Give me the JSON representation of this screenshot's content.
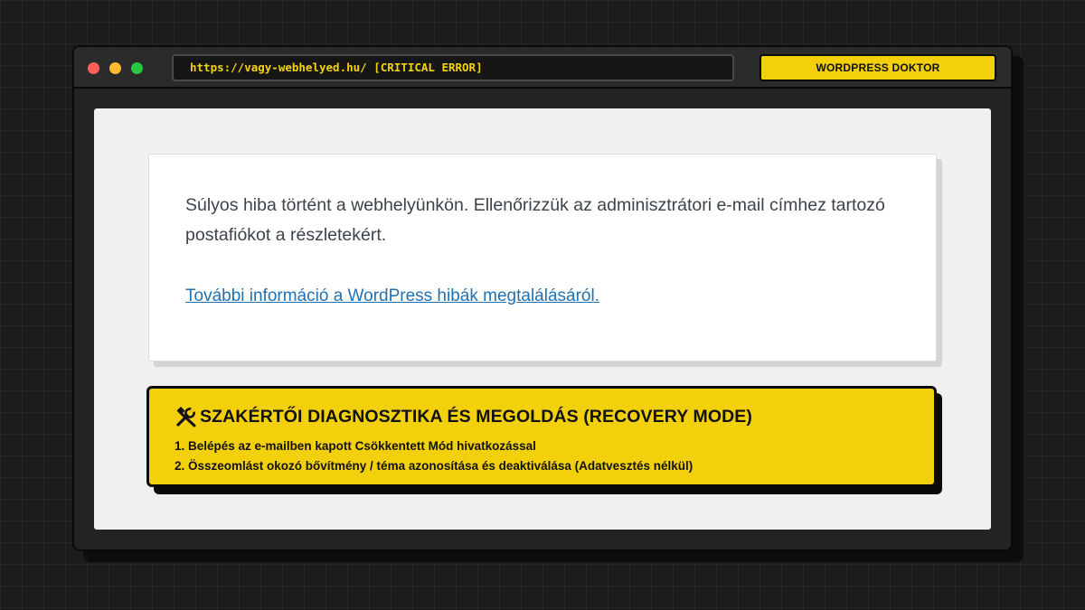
{
  "window": {
    "url": "https://vagy-webhelyed.hu/ [CRITICAL ERROR]",
    "doctor_button_label": "WORDPRESS DOKTOR"
  },
  "error_card": {
    "message": "Súlyos hiba történt a webhelyünkön. Ellenőrizzük az adminisztrátori e-mail címhez tartozó postafiókot a részletekért.",
    "link_text": "További információ a WordPress hibák megtalálásáról."
  },
  "diagnostics": {
    "icon": "tools-icon",
    "title": "SZAKÉRTŐI DIAGNOSZTIKA ÉS MEGOLDÁS (RECOVERY MODE)",
    "steps": [
      "1. Belépés az e-mailben kapott Csökkentett Mód hivatkozással",
      "2. Összeomlást okozó bővítmény / téma azonosítása és deaktiválása (Adatvesztés nélkül)"
    ]
  },
  "colors": {
    "accent_yellow": "#f2d00c",
    "link_blue": "#2271b1",
    "background": "#1c1c1c"
  }
}
